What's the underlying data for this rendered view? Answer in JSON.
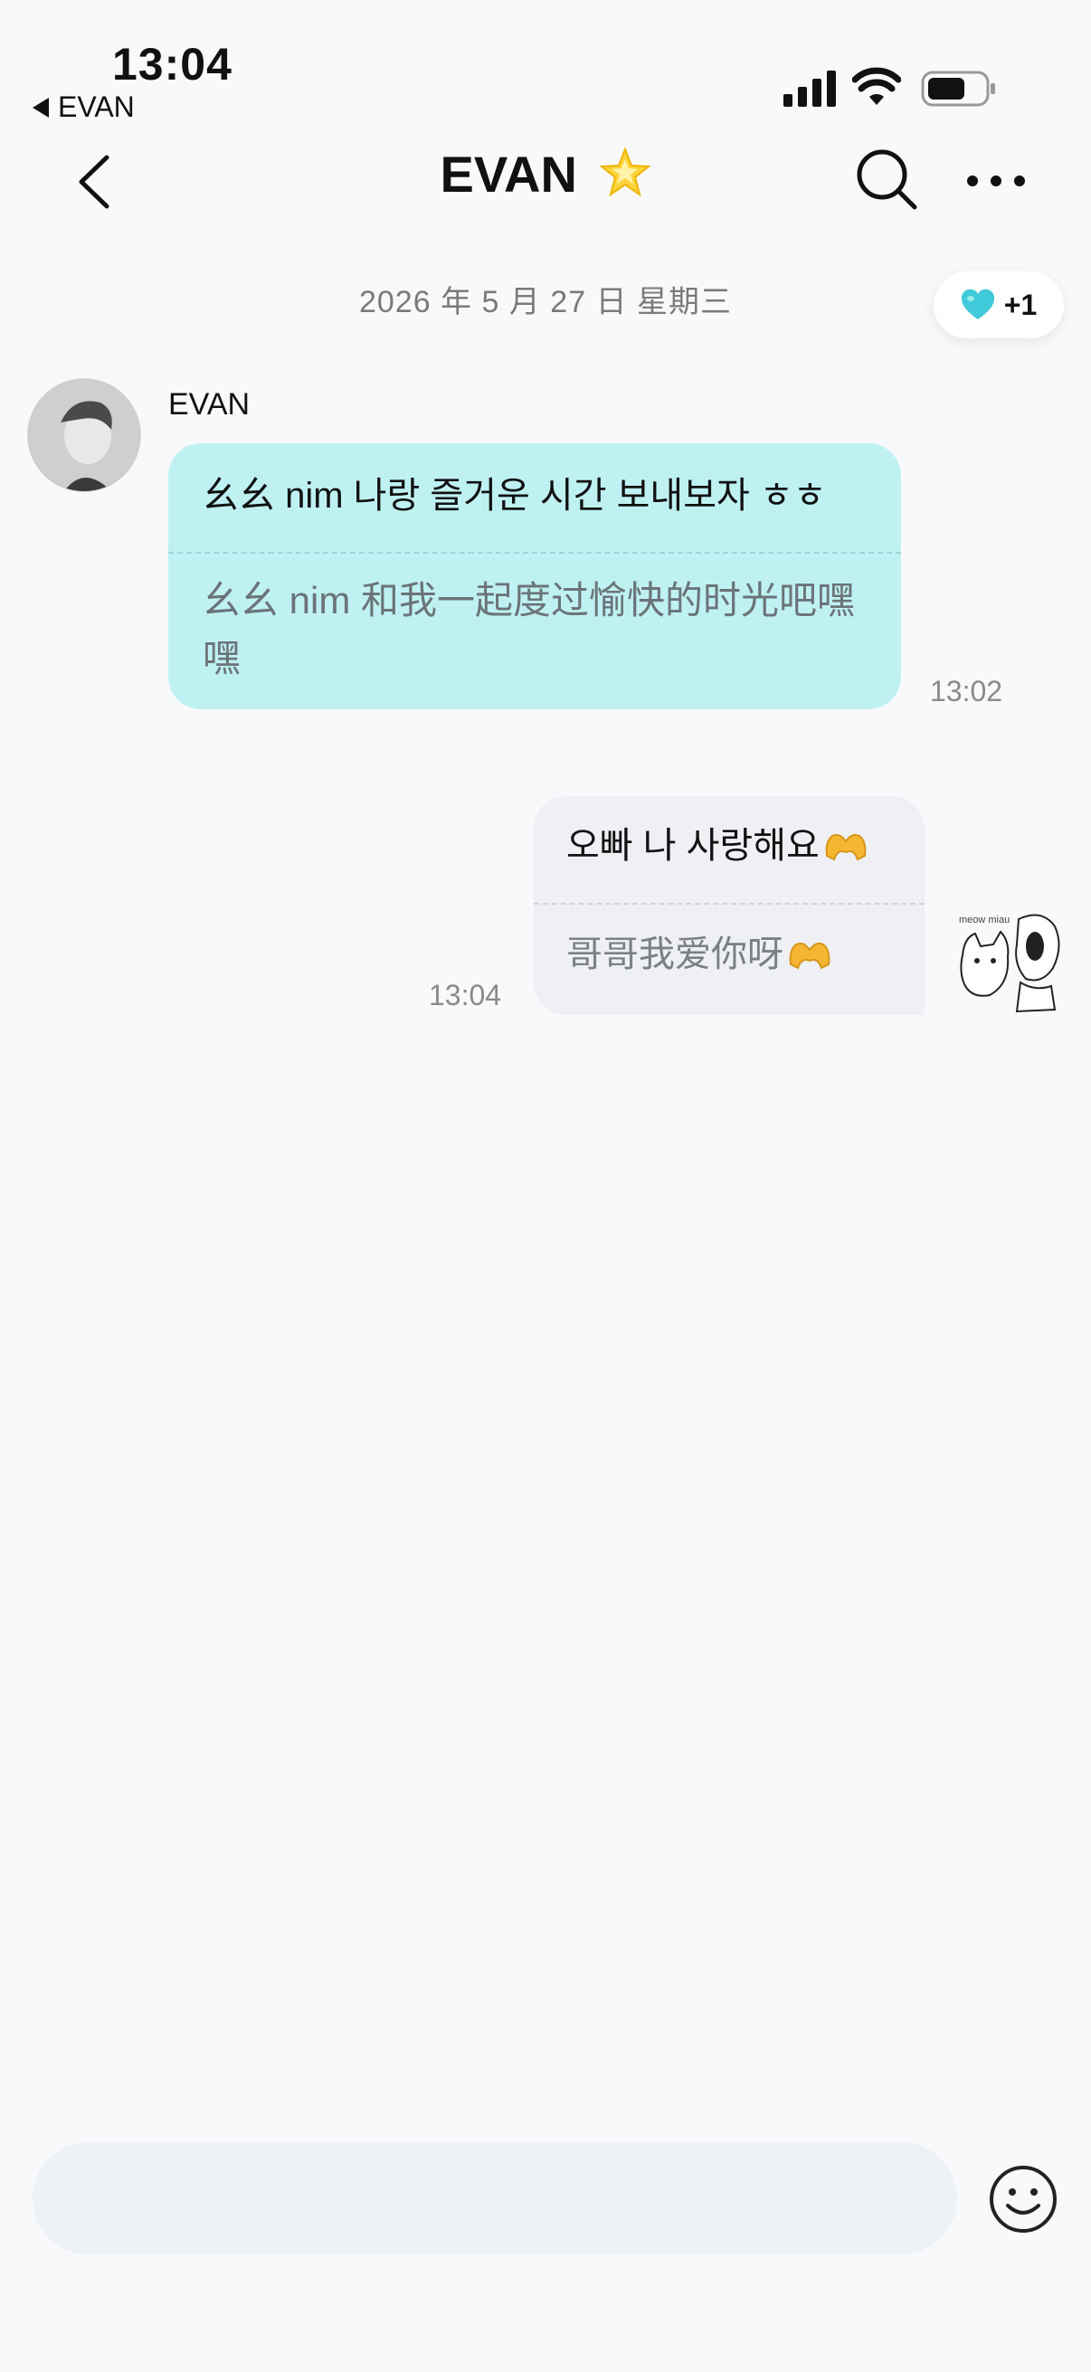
{
  "status_bar": {
    "time": "13:04",
    "back_app": "EVAN"
  },
  "header": {
    "title": "EVAN",
    "title_emoji": "star-icon"
  },
  "chat": {
    "date": "2026 年 5 月 27 日 星期三",
    "reaction": {
      "icon": "heart-icon",
      "count": "+1",
      "color": "#40c9d8"
    },
    "messages": [
      {
        "direction": "incoming",
        "sender": "EVAN",
        "original": "幺幺 nim 나랑 즐거운 시간 보내보자 ㅎㅎ",
        "translation": "幺幺 nim 和我一起度过愉快的时光吧嘿嘿",
        "time": "13:02"
      },
      {
        "direction": "outgoing",
        "original": "오빠 나 사랑해요",
        "translation": "哥哥我爱你呀",
        "time": "13:04",
        "emoji": "heart-hands-icon",
        "sticker_text": "meow miau"
      }
    ]
  },
  "composer": {
    "placeholder": ""
  },
  "colors": {
    "incoming_bubble": "#bff1f3",
    "outgoing_bubble": "#eef0f4",
    "background": "#f8f9fb"
  }
}
